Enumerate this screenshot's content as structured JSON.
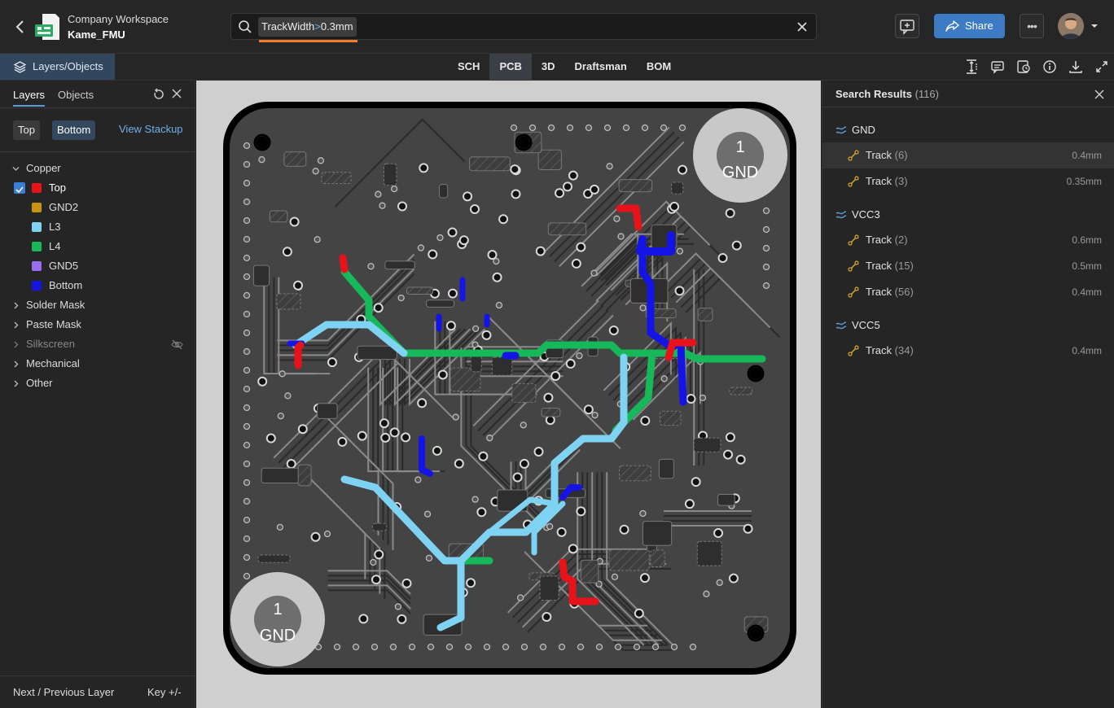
{
  "header": {
    "workspace": "Company Workspace",
    "project": "Kame_FMU",
    "search": {
      "chip_field": "TrackWidth",
      "chip_op": ">",
      "chip_value": "0.3mm"
    },
    "share_label": "Share",
    "more_label": "•••"
  },
  "subbar": {
    "panel_tab": "Layers/Objects",
    "views": [
      "SCH",
      "PCB",
      "3D",
      "Draftsman",
      "BOM"
    ],
    "active_view": "PCB"
  },
  "left_panel": {
    "tabs": [
      "Layers",
      "Objects"
    ],
    "active_tab": "Layers",
    "side_buttons": [
      "Top",
      "Bottom"
    ],
    "active_side": "Bottom",
    "stackup_link": "View Stackup",
    "groups": {
      "copper": "Copper",
      "solder_mask": "Solder Mask",
      "paste_mask": "Paste Mask",
      "silkscreen": "Silkscreen",
      "mechanical": "Mechanical",
      "other": "Other"
    },
    "copper_layers": [
      {
        "name": "Top",
        "color": "#e8121a",
        "checked": true
      },
      {
        "name": "GND2",
        "color": "#c79310",
        "checked": false
      },
      {
        "name": "L3",
        "color": "#7fd3f2",
        "checked": false
      },
      {
        "name": "L4",
        "color": "#16b85a",
        "checked": false
      },
      {
        "name": "GND5",
        "color": "#9a6cf0",
        "checked": false
      },
      {
        "name": "Bottom",
        "color": "#1414e6",
        "checked": false
      }
    ],
    "footer_left": "Next / Previous Layer",
    "footer_right": "Key +/-"
  },
  "canvas": {
    "board_labels": {
      "pin": "1",
      "net": "GND"
    }
  },
  "search_results": {
    "title": "Search Results",
    "count": "(116)",
    "nets": [
      {
        "name": "GND",
        "tracks": [
          {
            "label": "Track",
            "count": "(6)",
            "width": "0.4mm",
            "highlighted": true
          },
          {
            "label": "Track",
            "count": "(3)",
            "width": "0.35mm"
          }
        ]
      },
      {
        "name": "VCC3",
        "tracks": [
          {
            "label": "Track",
            "count": "(2)",
            "width": "0.6mm"
          },
          {
            "label": "Track",
            "count": "(15)",
            "width": "0.5mm"
          },
          {
            "label": "Track",
            "count": "(56)",
            "width": "0.4mm"
          }
        ]
      },
      {
        "name": "VCC5",
        "tracks": [
          {
            "label": "Track",
            "count": "(34)",
            "width": "0.4mm"
          }
        ]
      }
    ]
  }
}
